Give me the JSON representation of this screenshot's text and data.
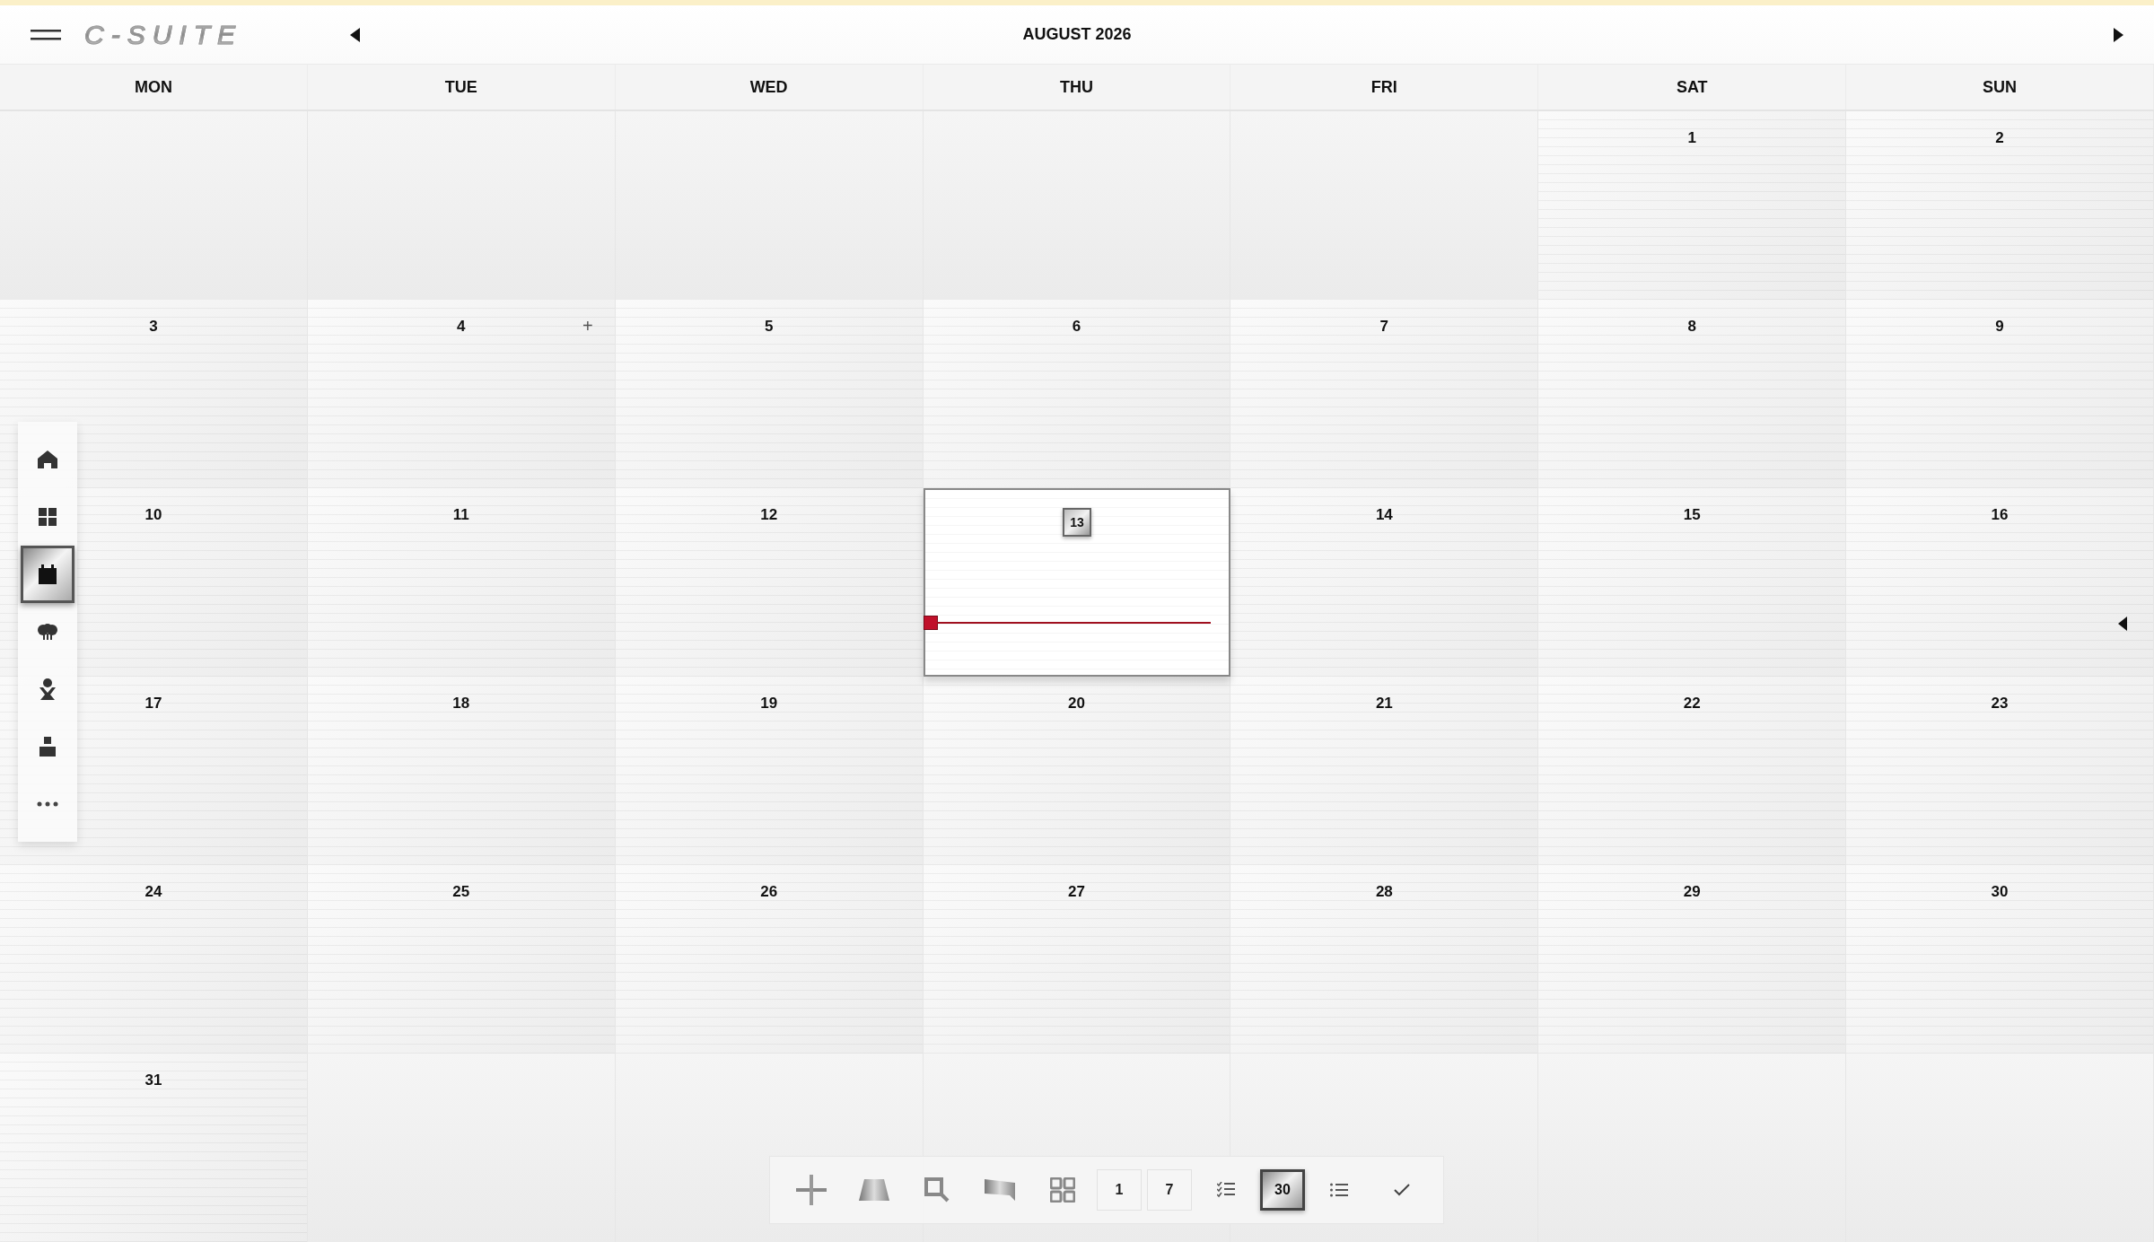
{
  "header": {
    "logo": "C-SUITE",
    "title": "AUGUST 2026"
  },
  "weekdays": [
    "MON",
    "TUE",
    "WED",
    "THU",
    "FRI",
    "SAT",
    "SUN"
  ],
  "weeks": [
    [
      {
        "in_month": false,
        "selected": false
      },
      {
        "in_month": false,
        "selected": false
      },
      {
        "in_month": false,
        "selected": false
      },
      {
        "in_month": false,
        "selected": false
      },
      {
        "in_month": false,
        "selected": false
      },
      {
        "in_month": true,
        "label": "1",
        "selected": false
      },
      {
        "in_month": true,
        "label": "2",
        "selected": false
      }
    ],
    [
      {
        "in_month": true,
        "label": "3",
        "selected": false
      },
      {
        "in_month": true,
        "label": "4",
        "selected": false,
        "add_button": "+"
      },
      {
        "in_month": true,
        "label": "5",
        "selected": false
      },
      {
        "in_month": true,
        "label": "6",
        "selected": false
      },
      {
        "in_month": true,
        "label": "7",
        "selected": false
      },
      {
        "in_month": true,
        "label": "8",
        "selected": false
      },
      {
        "in_month": true,
        "label": "9",
        "selected": false
      }
    ],
    [
      {
        "in_month": true,
        "label": "10",
        "selected": false
      },
      {
        "in_month": true,
        "label": "11",
        "selected": false
      },
      {
        "in_month": true,
        "label": "12",
        "selected": false
      },
      {
        "in_month": true,
        "label": "13",
        "selected": true
      },
      {
        "in_month": true,
        "label": "14",
        "selected": false
      },
      {
        "in_month": true,
        "label": "15",
        "selected": false
      },
      {
        "in_month": true,
        "label": "16",
        "selected": false
      }
    ],
    [
      {
        "in_month": true,
        "label": "17",
        "selected": false
      },
      {
        "in_month": true,
        "label": "18",
        "selected": false
      },
      {
        "in_month": true,
        "label": "19",
        "selected": false
      },
      {
        "in_month": true,
        "label": "20",
        "selected": false
      },
      {
        "in_month": true,
        "label": "21",
        "selected": false
      },
      {
        "in_month": true,
        "label": "22",
        "selected": false
      },
      {
        "in_month": true,
        "label": "23",
        "selected": false
      }
    ],
    [
      {
        "in_month": true,
        "label": "24",
        "selected": false
      },
      {
        "in_month": true,
        "label": "25",
        "selected": false
      },
      {
        "in_month": true,
        "label": "26",
        "selected": false
      },
      {
        "in_month": true,
        "label": "27",
        "selected": false
      },
      {
        "in_month": true,
        "label": "28",
        "selected": false
      },
      {
        "in_month": true,
        "label": "29",
        "selected": false
      },
      {
        "in_month": true,
        "label": "30",
        "selected": false
      }
    ],
    [
      {
        "in_month": true,
        "label": "31",
        "selected": false
      },
      {
        "in_month": false,
        "selected": false
      },
      {
        "in_month": false,
        "selected": false
      },
      {
        "in_month": false,
        "selected": false
      },
      {
        "in_month": false,
        "selected": false
      },
      {
        "in_month": false,
        "selected": false
      },
      {
        "in_month": false,
        "selected": false
      }
    ]
  ],
  "sidebar": {
    "items": [
      {
        "kind": "home",
        "selected": false
      },
      {
        "kind": "grid",
        "selected": false
      },
      {
        "kind": "calendar",
        "selected": true
      },
      {
        "kind": "tree",
        "selected": false
      },
      {
        "kind": "person",
        "selected": false
      },
      {
        "kind": "block",
        "selected": false
      },
      {
        "kind": "more",
        "selected": false
      }
    ]
  },
  "toolbar": {
    "items": [
      {
        "kind": "add",
        "selected": false
      },
      {
        "kind": "dome",
        "selected": false
      },
      {
        "kind": "search",
        "selected": false
      },
      {
        "kind": "flag",
        "selected": false
      },
      {
        "kind": "grid",
        "selected": false
      },
      {
        "kind": "text",
        "label": "1",
        "selected": false
      },
      {
        "kind": "text",
        "label": "7",
        "selected": false
      },
      {
        "kind": "checklist",
        "selected": false
      },
      {
        "kind": "text",
        "label": "30",
        "selected": true
      },
      {
        "kind": "list",
        "selected": false
      },
      {
        "kind": "check",
        "selected": false
      }
    ]
  }
}
